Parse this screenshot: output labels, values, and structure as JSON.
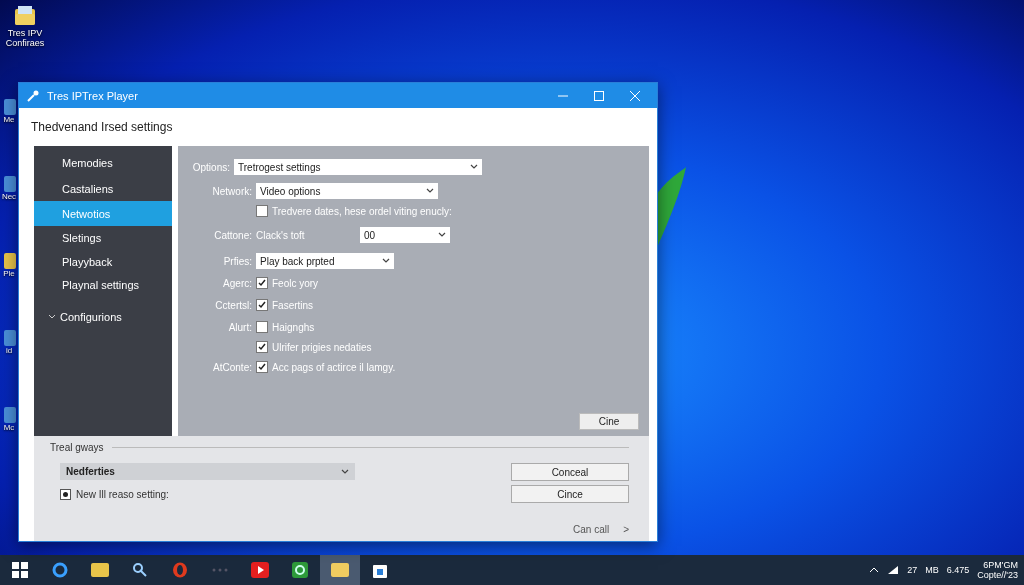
{
  "desktop": {
    "icons": [
      {
        "label": "Tres IPV Confiraes"
      },
      {
        "label": "Me"
      },
      {
        "label": "Nec"
      },
      {
        "label": "Ple"
      },
      {
        "label": "id"
      },
      {
        "label": "Mc"
      }
    ]
  },
  "window": {
    "title": "Tres IPTrex Player",
    "heading": "Thedvenand Irsed settings"
  },
  "sidebar": {
    "items": [
      {
        "label": "Memodies",
        "selected": false
      },
      {
        "label": "Castaliens",
        "selected": false
      },
      {
        "label": "Netwotios",
        "selected": true
      },
      {
        "label": "Sletings",
        "selected": false
      },
      {
        "label": "Playyback",
        "selected": false
      },
      {
        "label": "Playnal settings",
        "selected": false
      },
      {
        "label": "Configurions",
        "selected": false,
        "expanded": true
      }
    ]
  },
  "form": {
    "rows": [
      {
        "kind": "select",
        "label": "Options:",
        "value": "Tretrogest settings"
      },
      {
        "kind": "select",
        "label": "Network:",
        "value": "Video options"
      },
      {
        "kind": "check",
        "text": "Tredvere dates, hese ordel viting enucly:",
        "checked": false
      },
      {
        "kind": "pair",
        "label": "Cattone:",
        "text": "Clack's toft",
        "value": "00"
      },
      {
        "kind": "select",
        "label": "Prfies:",
        "value": "Play back prpted"
      },
      {
        "kind": "check",
        "label": "Agerc:",
        "text": "Feolc yory",
        "checked": true
      },
      {
        "kind": "check",
        "label": "Cctertsl:",
        "text": "Fasertins",
        "checked": true
      },
      {
        "kind": "check",
        "label": "Alurt:",
        "text": "Haignghs",
        "checked": false
      },
      {
        "kind": "check",
        "text": "Ulrifer prigies nedaties",
        "checked": true
      },
      {
        "kind": "check",
        "label": "AtConte:",
        "text": "Acc pags of actirce il lamgy.",
        "checked": true
      }
    ],
    "button": "Cine"
  },
  "footer": {
    "group_label": "Treal gways",
    "dropdown": "Nedferties",
    "radio": {
      "label": "New Ill reaso setting:",
      "selected": true
    },
    "buttons": [
      "Conceal",
      "Cince"
    ],
    "link": "Can call",
    "link_arrow": ">"
  },
  "taskbar": {
    "tray": [
      "27",
      "MB",
      "6.475"
    ],
    "clock": [
      "6PM'GM",
      "Copte//'23"
    ]
  }
}
